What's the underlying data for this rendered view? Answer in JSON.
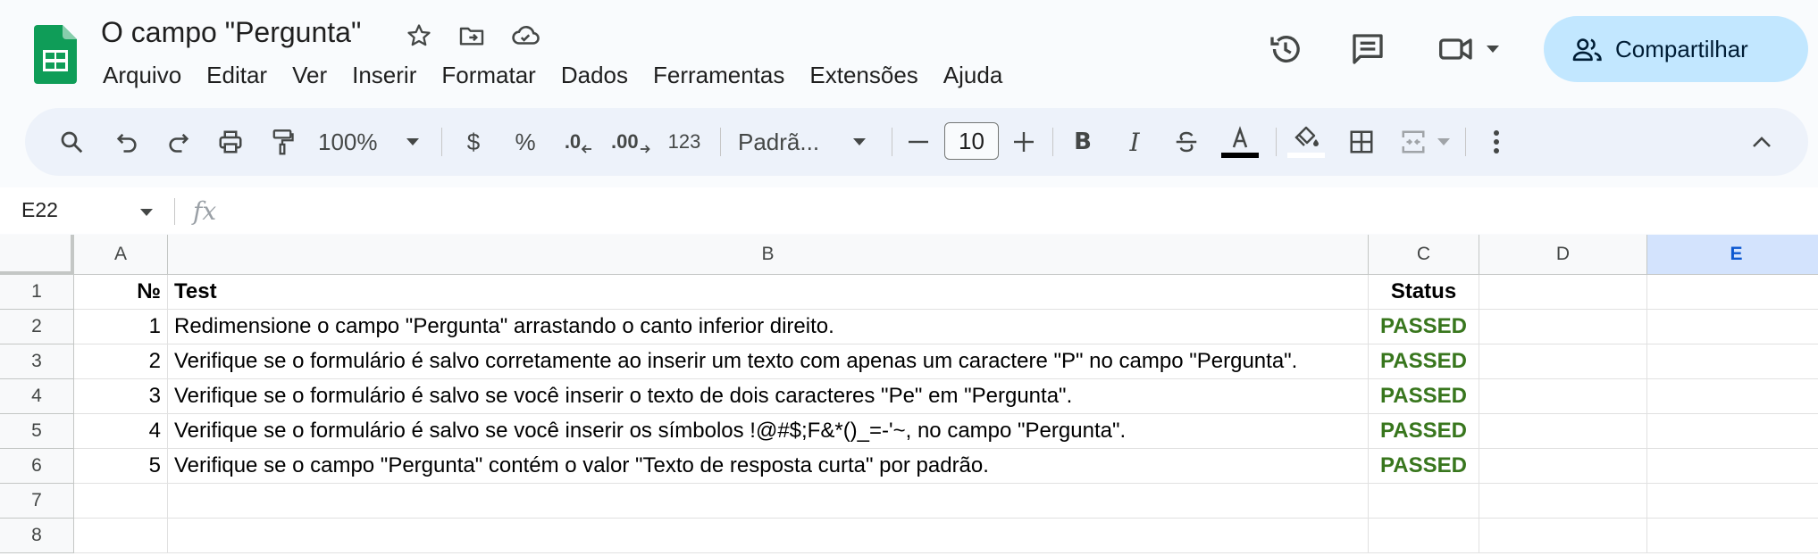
{
  "doc": {
    "title": "O campo \"Pergunta\"",
    "menu": [
      "Arquivo",
      "Editar",
      "Ver",
      "Inserir",
      "Formatar",
      "Dados",
      "Ferramentas",
      "Extensões",
      "Ajuda"
    ],
    "share_label": "Compartilhar"
  },
  "toolbar": {
    "zoom": "100%",
    "currency": "$",
    "percent": "%",
    "decrease_decimal": ".0",
    "increase_decimal": ".00",
    "more_formats": "123",
    "font": "Padrã...",
    "font_size": "10",
    "bold": "B",
    "italic": "I"
  },
  "formula_bar": {
    "name_box": "E22",
    "fx": "fx",
    "value": ""
  },
  "grid": {
    "columns": [
      "A",
      "B",
      "C",
      "D",
      "E"
    ],
    "selected_column": "E",
    "row_numbers": [
      "1",
      "2",
      "3",
      "4",
      "5",
      "6",
      "7",
      "8"
    ],
    "rows": [
      [
        "№",
        "Test",
        "Status",
        "",
        ""
      ],
      [
        "1",
        "Redimensione o campo \"Pergunta\" arrastando o canto inferior direito.",
        "PASSED",
        "",
        ""
      ],
      [
        "2",
        "Verifique se o formulário é salvo corretamente ao inserir um texto com apenas um caractere \"P\" no campo \"Pergunta\".",
        "PASSED",
        "",
        ""
      ],
      [
        "3",
        "Verifique se o formulário é salvo se você inserir o texto de dois caracteres \"Pe\" em \"Pergunta\".",
        "PASSED",
        "",
        ""
      ],
      [
        "4",
        "Verifique se o formulário é salvo se você inserir os símbolos !@#$;F&*()_=-'~, no campo \"Pergunta\".",
        "PASSED",
        "",
        ""
      ],
      [
        "5",
        "Verifique se o campo \"Pergunta\" contém o valor \"Texto de resposta curta\" por padrão.",
        "PASSED",
        "",
        ""
      ],
      [
        "",
        "",
        "",
        "",
        ""
      ],
      [
        "",
        "",
        "",
        "",
        ""
      ]
    ]
  },
  "colors": {
    "accent": "#0b57d0",
    "share_bg": "#c2e7ff",
    "toolbar_bg": "#edf2fa",
    "passed": "#38761d",
    "sheets_green": "#0f9d58"
  }
}
